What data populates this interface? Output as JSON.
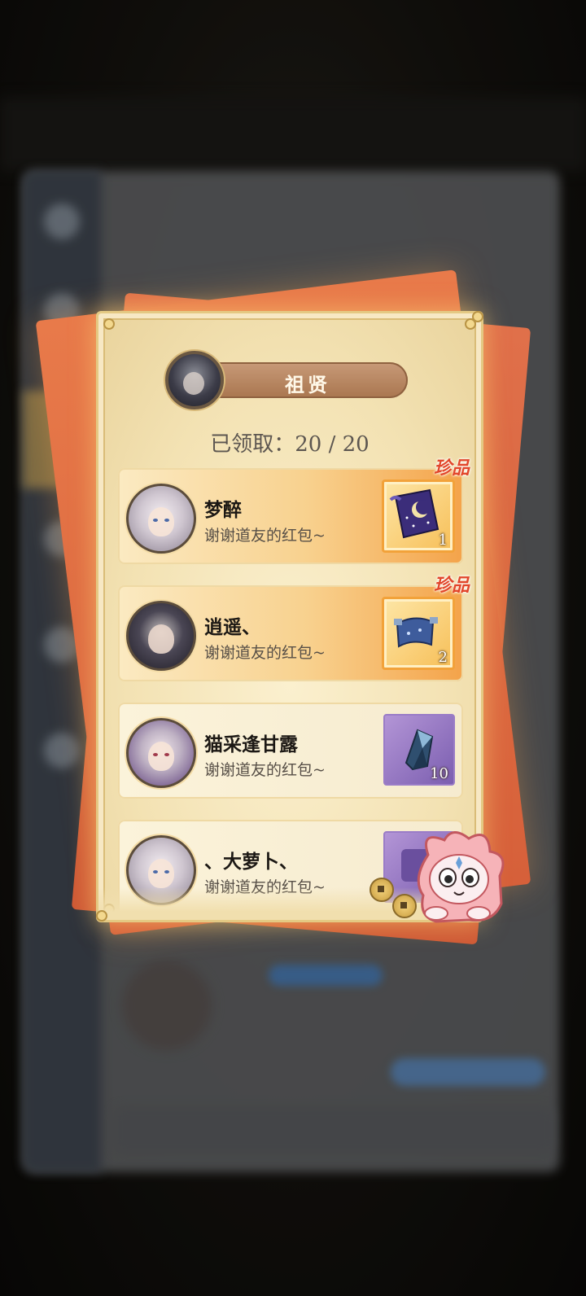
{
  "header": {
    "host_name": "祖贤",
    "count_text": "已领取：20 / 20"
  },
  "rows": [
    {
      "name": "梦醉",
      "message": "谢谢道友的红包~",
      "quantity": "1",
      "rare": "珍品",
      "item_icon": "moon-banner-icon"
    },
    {
      "name": "逍遥、",
      "message": "谢谢道友的红包~",
      "quantity": "2",
      "rare": "珍品",
      "item_icon": "blue-scroll-icon"
    },
    {
      "name": "猫采逢甘露",
      "message": "谢谢道友的红包~",
      "quantity": "10",
      "rare": "",
      "item_icon": "blue-crystal-icon"
    },
    {
      "name": "、大萝卜、",
      "message": "谢谢道友的红包~",
      "quantity": "",
      "rare": "",
      "item_icon": "purple-item-icon"
    }
  ],
  "colors": {
    "rare_red": "#e2462b",
    "header_brown": "#a9764f",
    "card_orange": "#d6603a"
  }
}
